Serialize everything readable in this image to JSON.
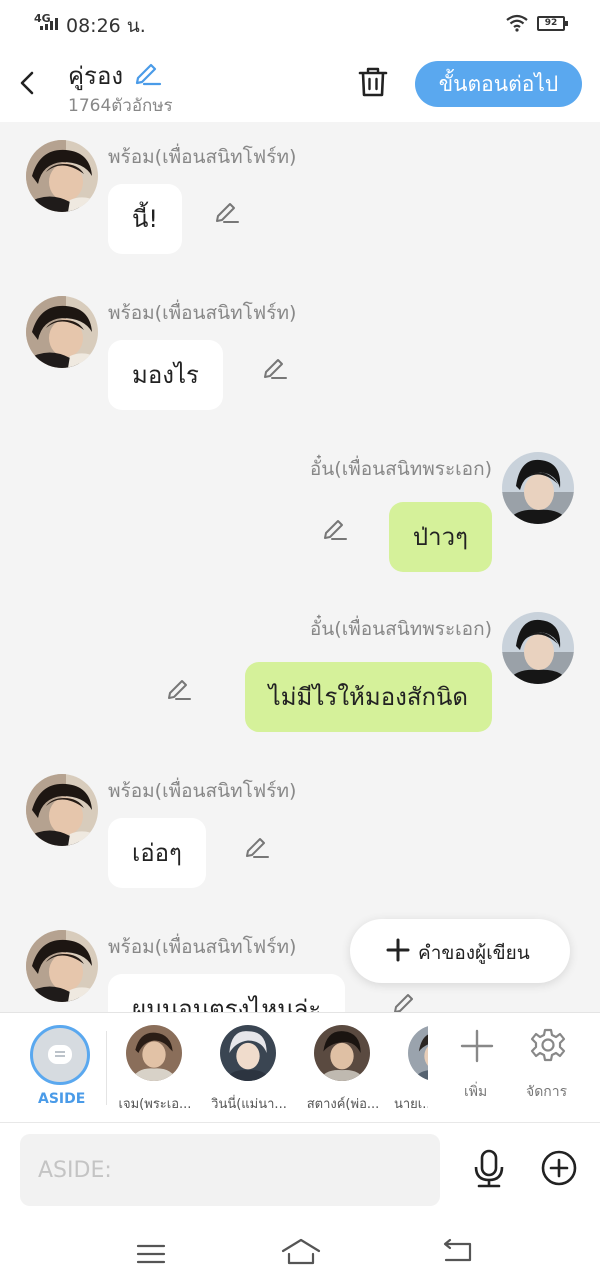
{
  "status": {
    "network": "4G",
    "time": "08:26 น.",
    "battery": "92"
  },
  "header": {
    "title": "คู่รอง",
    "subtitle": "1764ตัวอักษร",
    "next_label": "ขั้นตอนต่อไป"
  },
  "messages": [
    {
      "speaker": "พร้อม(เพื่อนสนิทโฟร์ท)",
      "text": "นี้!",
      "side": "left"
    },
    {
      "speaker": "พร้อม(เพื่อนสนิทโฟร์ท)",
      "text": "มองไร",
      "side": "left"
    },
    {
      "speaker": "อั๋น(เพื่อนสนิทพระเอก)",
      "text": "ป่าวๆ",
      "side": "right"
    },
    {
      "speaker": "อั๋น(เพื่อนสนิทพระเอก)",
      "text": "ไม่มีไรให้มองสักนิด",
      "side": "right"
    },
    {
      "speaker": "พร้อม(เพื่อนสนิทโฟร์ท)",
      "text": "เอ่อๆ",
      "side": "left"
    },
    {
      "speaker": "พร้อม(เพื่อนสนิทโฟร์ท)",
      "text": "ผมนอนตรงไหนล่ะ",
      "side": "left"
    }
  ],
  "fab": {
    "label": "คำของผู้เขียน"
  },
  "characters": {
    "aside_label": "ASIDE",
    "items": [
      {
        "label": "เจม(พระเอ..."
      },
      {
        "label": "วินนี่(แม่นา..."
      },
      {
        "label": "สตางค์(พ่อ..."
      },
      {
        "label": "นายเ..."
      }
    ],
    "add_label": "เพิ่ม",
    "manage_label": "จัดการ"
  },
  "input": {
    "placeholder": "ASIDE:"
  },
  "colors": {
    "accent": "#5aa8ef",
    "my_bubble": "#d5f19a",
    "other_bubble": "#ffffff"
  }
}
